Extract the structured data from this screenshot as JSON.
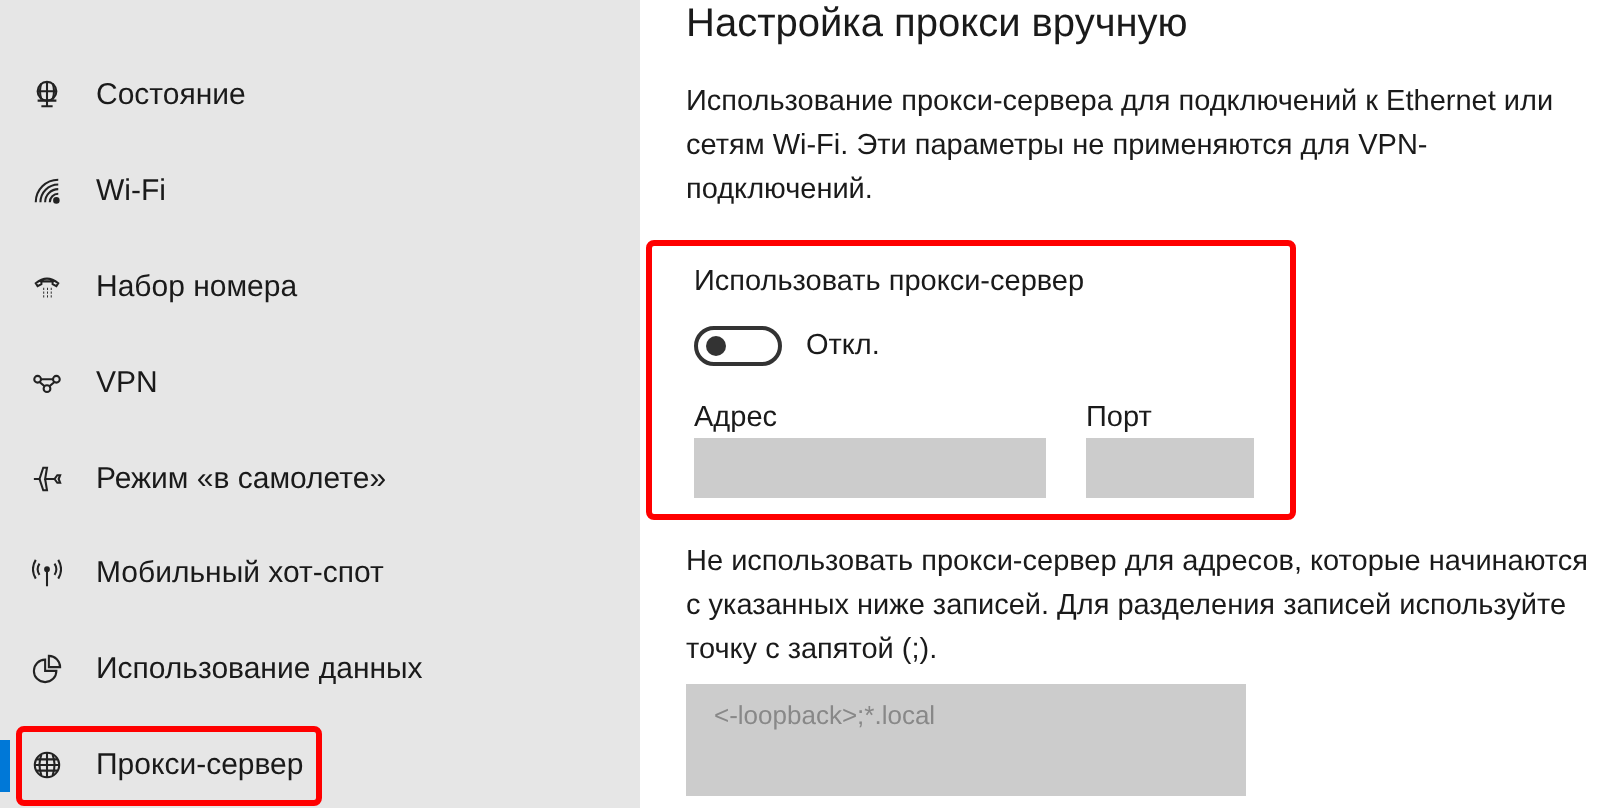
{
  "sidebar": {
    "items": [
      {
        "kind": "status",
        "label": "Состояние",
        "selected": false,
        "highlighted": false
      },
      {
        "kind": "wifi",
        "label": "Wi-Fi",
        "selected": false,
        "highlighted": false
      },
      {
        "kind": "dialup",
        "label": "Набор номера",
        "selected": false,
        "highlighted": false
      },
      {
        "kind": "vpn",
        "label": "VPN",
        "selected": false,
        "highlighted": false
      },
      {
        "kind": "airplane",
        "label": "Режим «в самолете»",
        "selected": false,
        "highlighted": false
      },
      {
        "kind": "hotspot",
        "label": "Мобильный хот-спот",
        "selected": false,
        "highlighted": false
      },
      {
        "kind": "data",
        "label": "Использование данных",
        "selected": false,
        "highlighted": false
      },
      {
        "kind": "globe",
        "label": "Прокси-сервер",
        "selected": true,
        "highlighted": true
      }
    ]
  },
  "content": {
    "title": "Настройка прокси вручную",
    "description": "Использование прокси-сервера для подключений к Ethernet или сетям Wi-Fi. Эти параметры не применяются для VPN-подключений.",
    "proxy": {
      "highlighted": true,
      "label": "Использовать прокси-сервер",
      "toggle": {
        "on": false,
        "state_text": "Откл."
      },
      "address": {
        "label": "Адрес",
        "disabled": true
      },
      "port": {
        "label": "Порт",
        "disabled": true
      }
    },
    "exceptions": {
      "description": "Не использовать прокси-сервер для адресов, которые начинаются с указанных ниже записей. Для разделения записей используйте точку с запятой (;).",
      "value": "<-loopback>;*.local",
      "disabled": true
    }
  }
}
